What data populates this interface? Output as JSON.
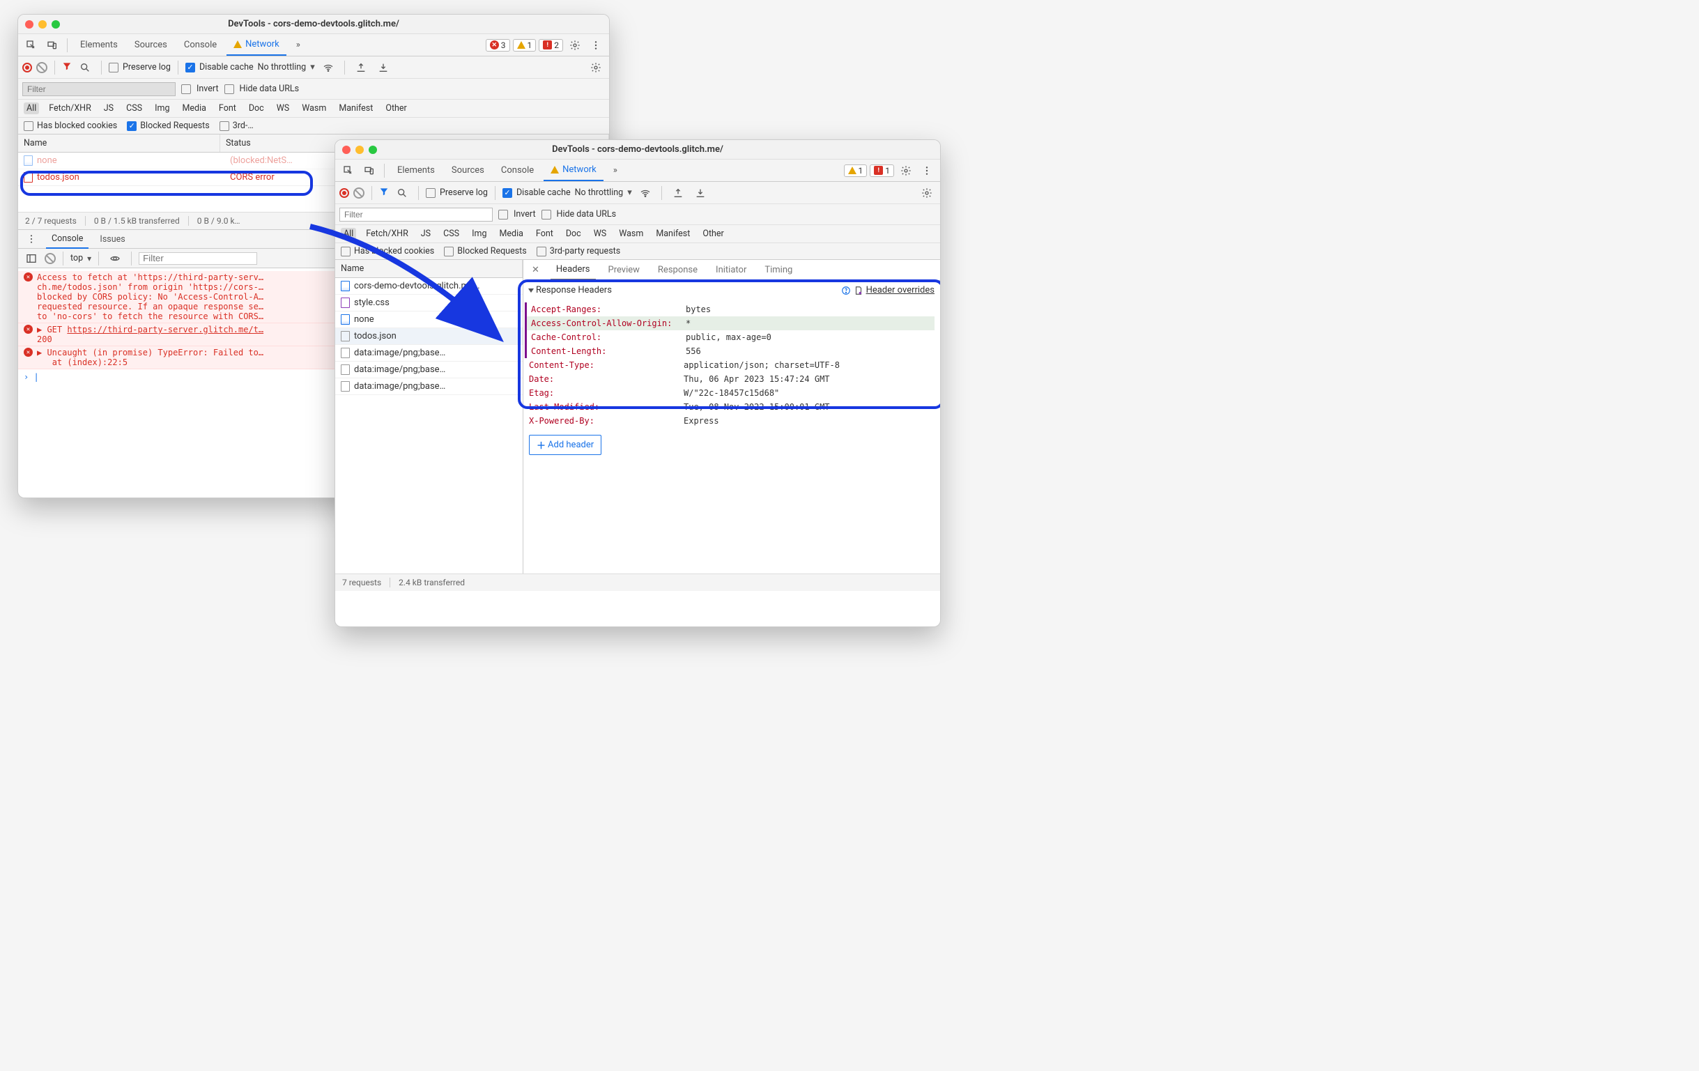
{
  "window1": {
    "title": "DevTools - cors-demo-devtools.glitch.me/",
    "tabs": {
      "elements": "Elements",
      "sources": "Sources",
      "console": "Console",
      "network": "Network",
      "more": "»"
    },
    "badges": {
      "errors": "3",
      "warnings": "1",
      "issues": "2"
    },
    "tb2": {
      "preserve": "Preserve log",
      "disable": "Disable cache",
      "throttle": "No throttling"
    },
    "tb3": {
      "filter_ph": "Filter",
      "invert": "Invert",
      "hide": "Hide data URLs"
    },
    "chips": [
      "All",
      "Fetch/XHR",
      "JS",
      "CSS",
      "Img",
      "Media",
      "Font",
      "Doc",
      "WS",
      "Wasm",
      "Manifest",
      "Other"
    ],
    "checks": {
      "blocked_cookies": "Has blocked cookies",
      "blocked_req": "Blocked Requests",
      "third": "3rd-…"
    },
    "col_name": "Name",
    "col_status": "Status",
    "rows": [
      {
        "name": "none",
        "status": "(blocked:NetS…"
      },
      {
        "name": "todos.json",
        "status": "CORS error"
      }
    ],
    "status_bar": {
      "a": "2 / 7 requests",
      "b": "0 B / 1.5 kB transferred",
      "c": "0 B / 9.0 k…"
    },
    "drawer": {
      "console": "Console",
      "issues": "Issues",
      "top": "top",
      "filter_ph": "Filter"
    },
    "console_lines": {
      "l1": "Access to fetch at 'https://third-party-serv…\nch.me/todos.json' from origin 'https://cors-…\nblocked by CORS policy: No 'Access-Control-A…\nrequested resource. If an opaque response se…\nto 'no-cors' to fetch the resource with CORS…",
      "l2_pre": "▶ GET ",
      "l2_link": "https://third-party-server.glitch.me/t…",
      "l2_b": "200",
      "l3": "▶ Uncaught (in promise) TypeError: Failed to…\n   at (index):22:5"
    }
  },
  "window2": {
    "title": "DevTools - cors-demo-devtools.glitch.me/",
    "tabs": {
      "elements": "Elements",
      "sources": "Sources",
      "console": "Console",
      "network": "Network",
      "more": "»"
    },
    "badges": {
      "warnings": "1",
      "issues": "1"
    },
    "tb2": {
      "preserve": "Preserve log",
      "disable": "Disable cache",
      "throttle": "No throttling"
    },
    "tb3": {
      "filter_ph": "Filter",
      "invert": "Invert",
      "hide": "Hide data URLs"
    },
    "chips": [
      "All",
      "Fetch/XHR",
      "JS",
      "CSS",
      "Img",
      "Media",
      "Font",
      "Doc",
      "WS",
      "Wasm",
      "Manifest",
      "Other"
    ],
    "checks": {
      "blocked_cookies": "Has blocked cookies",
      "blocked_req": "Blocked Requests",
      "third": "3rd-party requests"
    },
    "col_name": "Name",
    "rows": [
      {
        "name": "cors-demo-devtools.glitch.me…",
        "icon": "blue"
      },
      {
        "name": "style.css",
        "icon": "purple"
      },
      {
        "name": "none",
        "icon": "blue"
      },
      {
        "name": "todos.json",
        "icon": "grey",
        "selected": true
      },
      {
        "name": "data:image/png;base…",
        "icon": "grey"
      },
      {
        "name": "data:image/png;base…",
        "icon": "grey"
      },
      {
        "name": "data:image/png;base…",
        "icon": "grey"
      }
    ],
    "detail_tabs": [
      "Headers",
      "Preview",
      "Response",
      "Initiator",
      "Timing"
    ],
    "section_title": "Response Headers",
    "header_overrides": "Header overrides",
    "headers": [
      {
        "k": "Accept-Ranges:",
        "v": "bytes"
      },
      {
        "k": "Access-Control-Allow-Origin:",
        "v": "*",
        "override": true
      },
      {
        "k": "Cache-Control:",
        "v": "public, max-age=0"
      },
      {
        "k": "Content-Length:",
        "v": "556"
      },
      {
        "k": "Content-Type:",
        "v": "application/json; charset=UTF-8"
      },
      {
        "k": "Date:",
        "v": "Thu, 06 Apr 2023 15:47:24 GMT"
      },
      {
        "k": "Etag:",
        "v": "W/\"22c-18457c15d68\""
      },
      {
        "k": "Last-Modified:",
        "v": "Tue, 08 Nov 2022 15:00:01 GMT"
      },
      {
        "k": "X-Powered-By:",
        "v": "Express"
      }
    ],
    "add_header": "Add header",
    "status_bar": {
      "a": "7 requests",
      "b": "2.4 kB transferred"
    }
  }
}
